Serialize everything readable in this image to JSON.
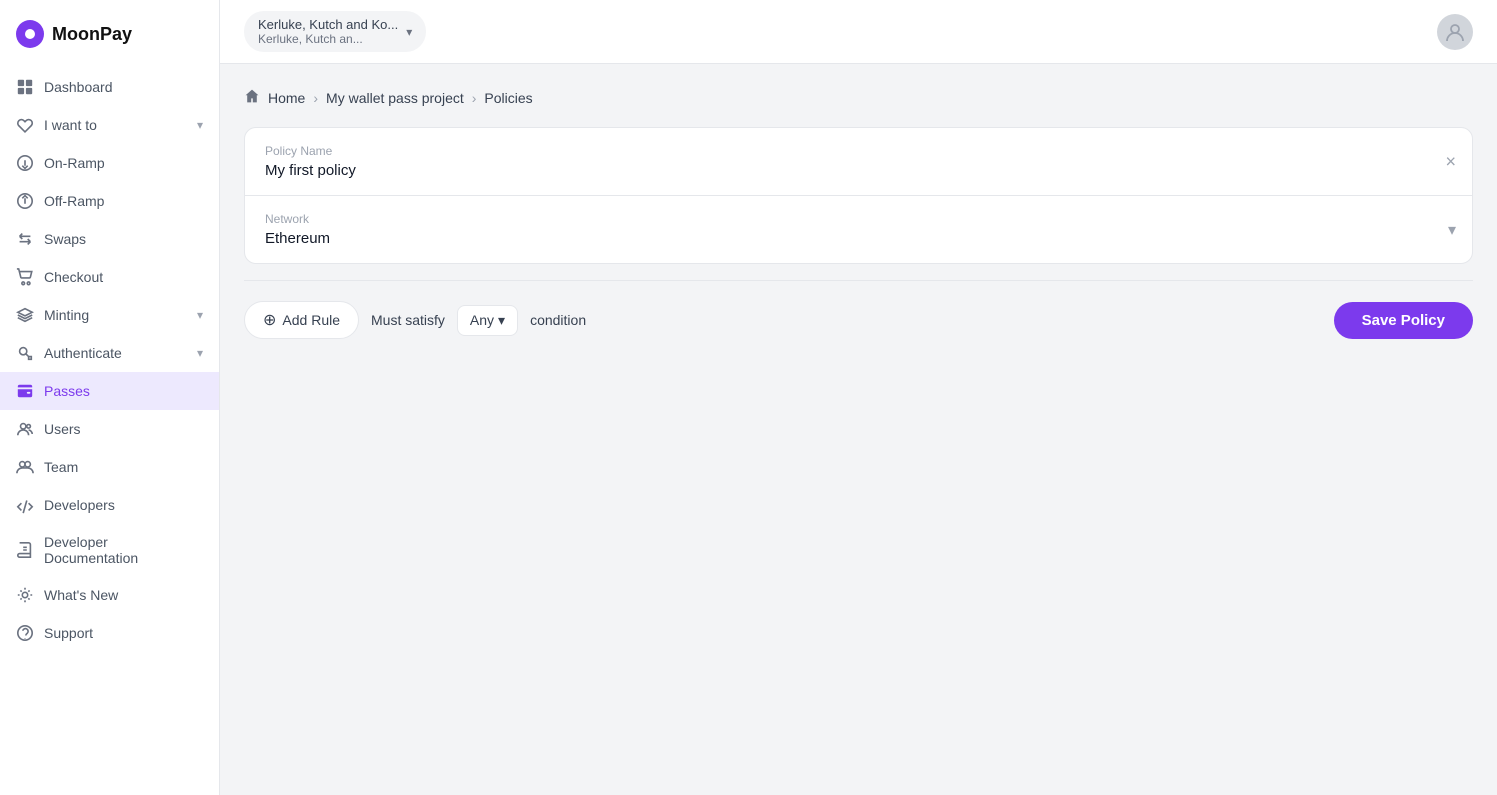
{
  "logo": {
    "text": "MoonPay"
  },
  "org": {
    "name": "Kerluke, Kutch and Ko...",
    "sub": "Kerluke, Kutch an..."
  },
  "sidebar": {
    "items": [
      {
        "id": "dashboard",
        "label": "Dashboard",
        "icon": "grid"
      },
      {
        "id": "i-want-to",
        "label": "I want to",
        "icon": "heart",
        "hasChevron": true
      },
      {
        "id": "on-ramp",
        "label": "On-Ramp",
        "icon": "arrow-down-circle"
      },
      {
        "id": "off-ramp",
        "label": "Off-Ramp",
        "icon": "arrow-up-circle"
      },
      {
        "id": "swaps",
        "label": "Swaps",
        "icon": "swap"
      },
      {
        "id": "checkout",
        "label": "Checkout",
        "icon": "shopping-cart"
      },
      {
        "id": "minting",
        "label": "Minting",
        "icon": "layers",
        "hasChevron": true
      },
      {
        "id": "authenticate",
        "label": "Authenticate",
        "icon": "key",
        "hasChevron": true
      },
      {
        "id": "passes",
        "label": "Passes",
        "icon": "wallet",
        "active": true
      },
      {
        "id": "users",
        "label": "Users",
        "icon": "users"
      },
      {
        "id": "team",
        "label": "Team",
        "icon": "user-group"
      },
      {
        "id": "developers",
        "label": "Developers",
        "icon": "code"
      },
      {
        "id": "developer-docs",
        "label": "Developer Documentation",
        "icon": "book"
      },
      {
        "id": "whats-new",
        "label": "What's New",
        "icon": "sparkle"
      },
      {
        "id": "support",
        "label": "Support",
        "icon": "support"
      }
    ]
  },
  "breadcrumb": {
    "home": "Home",
    "project": "My wallet pass project",
    "current": "Policies"
  },
  "form": {
    "policy_name_label": "Policy Name",
    "policy_name_value": "My first policy",
    "network_label": "Network",
    "network_value": "Ethereum"
  },
  "rule_bar": {
    "add_rule_label": "Add Rule",
    "must_satisfy": "Must satisfy",
    "any_label": "Any",
    "condition": "condition",
    "save_policy_label": "Save Policy"
  }
}
